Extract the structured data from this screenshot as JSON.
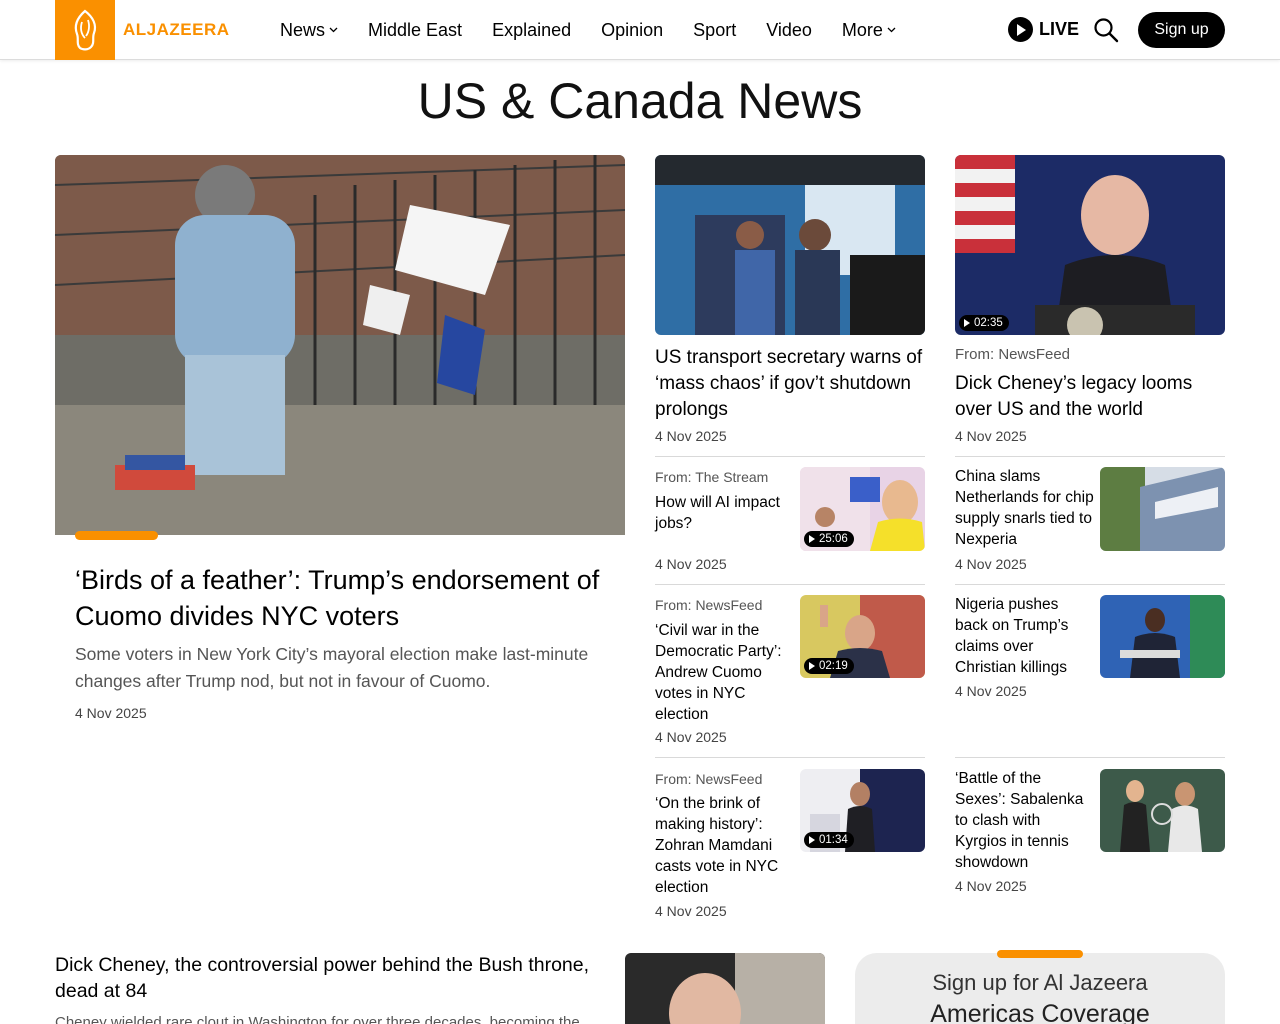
{
  "header": {
    "brand": "ALJAZEERA",
    "nav": [
      {
        "label": "News",
        "has_menu": true
      },
      {
        "label": "Middle East",
        "has_menu": false
      },
      {
        "label": "Explained",
        "has_menu": false
      },
      {
        "label": "Opinion",
        "has_menu": false
      },
      {
        "label": "Sport",
        "has_menu": false
      },
      {
        "label": "Video",
        "has_menu": false
      },
      {
        "label": "More",
        "has_menu": true
      }
    ],
    "live_label": "LIVE",
    "signup_label": "Sign up",
    "accent": "#fa9000"
  },
  "page_title": "US & Canada News",
  "feature": {
    "title": "‘Birds of a feather’: Trump’s endorsement of Cuomo divides NYC voters",
    "description": "Some voters in New York City’s mayoral election make last-minute changes after Trump nod, but not in favour of Cuomo.",
    "date": "4 Nov 2025"
  },
  "top_cards": [
    {
      "title": "US transport secretary warns of ‘mass chaos’ if gov’t shutdown prolongs",
      "date": "4 Nov 2025"
    },
    {
      "source": "From: NewsFeed",
      "title": "Dick Cheney’s legacy looms over US and the world",
      "date": "4 Nov 2025",
      "duration": "02:35"
    }
  ],
  "left_list": [
    {
      "source": "From: The Stream",
      "title": "How will AI impact jobs?",
      "date": "4 Nov 2025",
      "duration": "25:06"
    },
    {
      "source": "From: NewsFeed",
      "title": "‘Civil war in the Democratic Party’: Andrew Cuomo votes in NYC election",
      "date": "4 Nov 2025",
      "duration": "02:19"
    },
    {
      "source": "From: NewsFeed",
      "title": "‘On the brink of making history’: Zohran Mamdani casts vote in NYC election",
      "date": "4 Nov 2025",
      "duration": "01:34"
    }
  ],
  "right_list": [
    {
      "title": "China slams Netherlands for chip supply snarls tied to Nexperia",
      "date": "4 Nov 2025"
    },
    {
      "title": "Nigeria pushes back on Trump’s claims over Christian killings",
      "date": "4 Nov 2025"
    },
    {
      "title": "‘Battle of the Sexes’: Sabalenka to clash with Kyrgios in tennis showdown",
      "date": "4 Nov 2025"
    }
  ],
  "bottom": {
    "title": "Dick Cheney, the controversial power behind the Bush throne, dead at 84",
    "description": "Cheney wielded rare clout in Washington for over three decades, becoming the"
  },
  "signup_box": {
    "line1": "Sign up for Al Jazeera",
    "line2": "Americas Coverage"
  }
}
